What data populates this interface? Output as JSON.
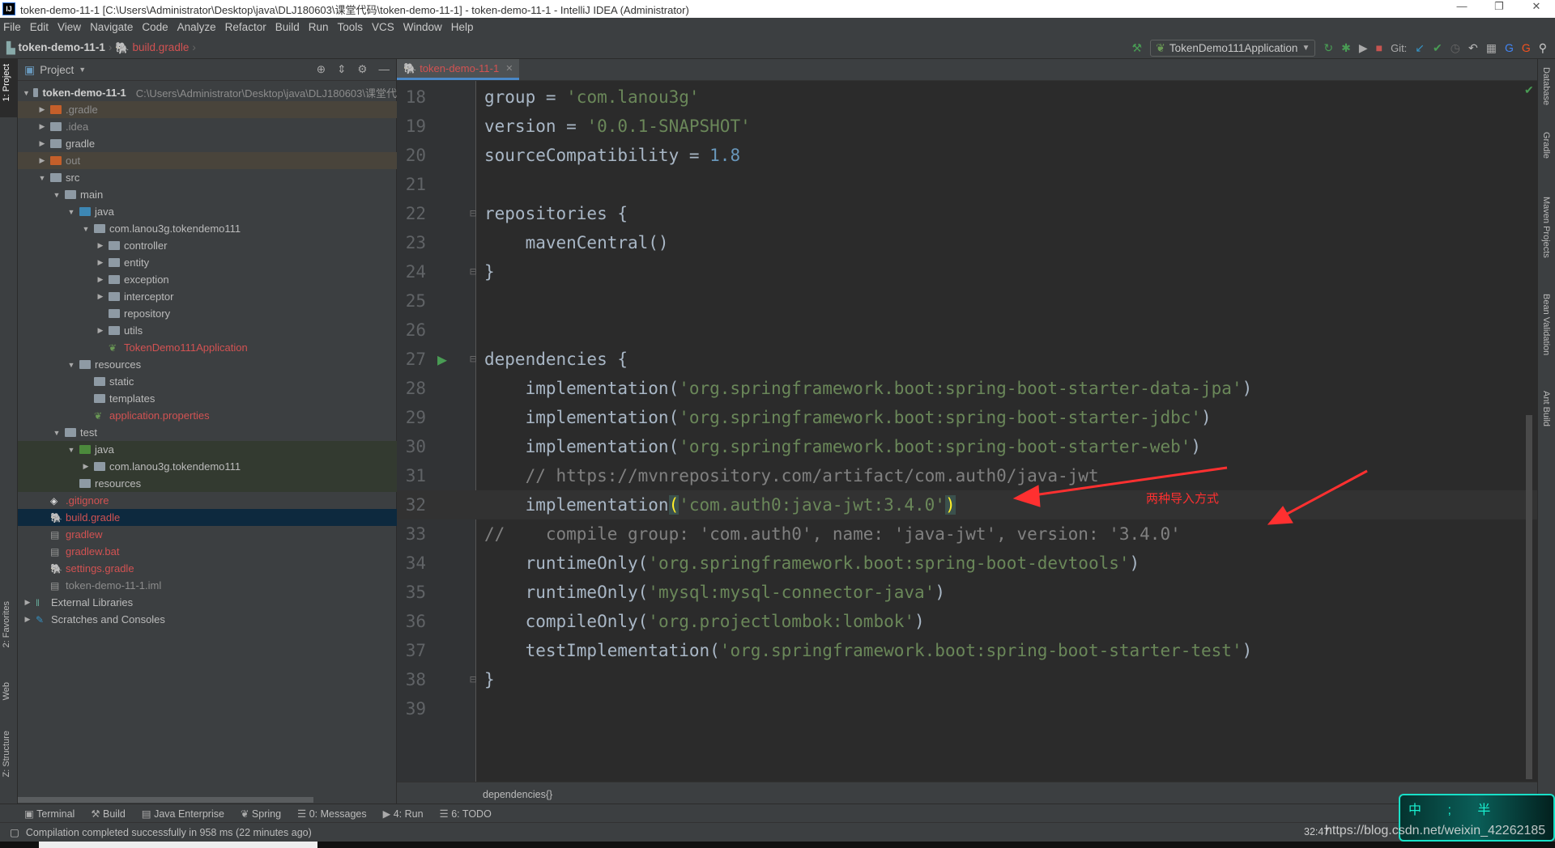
{
  "window": {
    "title": "token-demo-11-1 [C:\\Users\\Administrator\\Desktop\\java\\DLJ180603\\课堂代码\\token-demo-11-1] - token-demo-11-1 - IntelliJ IDEA (Administrator)",
    "logo": "IJ"
  },
  "menu": [
    "File",
    "Edit",
    "View",
    "Navigate",
    "Code",
    "Analyze",
    "Refactor",
    "Build",
    "Run",
    "Tools",
    "VCS",
    "Window",
    "Help"
  ],
  "nav": {
    "project": "token-demo-11-1",
    "file": "build.gradle"
  },
  "toolbar": {
    "run_config": "TokenDemo111Application",
    "git_label": "Git:"
  },
  "left_tabs": [
    "1: Project",
    "2: Favorites",
    "Web",
    "Z: Structure"
  ],
  "project_panel": {
    "title": "Project",
    "tree": [
      {
        "label": "token-demo-11-1",
        "path": "C:\\Users\\Administrator\\Desktop\\java\\DLJ180603\\课堂代",
        "depth": 0,
        "arrow": "down",
        "icon": "module",
        "style": "bold"
      },
      {
        "label": ".gradle",
        "depth": 1,
        "arrow": "right",
        "icon": "excluded",
        "style": "excluded"
      },
      {
        "label": ".idea",
        "depth": 1,
        "arrow": "right",
        "icon": "folder",
        "style": "dim"
      },
      {
        "label": "gradle",
        "depth": 1,
        "arrow": "right",
        "icon": "folder",
        "style": "normal"
      },
      {
        "label": "out",
        "depth": 1,
        "arrow": "right",
        "icon": "excluded",
        "style": "excluded"
      },
      {
        "label": "src",
        "depth": 1,
        "arrow": "down",
        "icon": "folder",
        "style": "normal"
      },
      {
        "label": "main",
        "depth": 2,
        "arrow": "down",
        "icon": "module",
        "style": "normal"
      },
      {
        "label": "java",
        "depth": 3,
        "arrow": "down",
        "icon": "source",
        "style": "normal"
      },
      {
        "label": "com.lanou3g.tokendemo111",
        "depth": 4,
        "arrow": "down",
        "icon": "package",
        "style": "normal"
      },
      {
        "label": "controller",
        "depth": 5,
        "arrow": "right",
        "icon": "package",
        "style": "normal"
      },
      {
        "label": "entity",
        "depth": 5,
        "arrow": "right",
        "icon": "package",
        "style": "normal"
      },
      {
        "label": "exception",
        "depth": 5,
        "arrow": "right",
        "icon": "package",
        "style": "normal"
      },
      {
        "label": "interceptor",
        "depth": 5,
        "arrow": "right",
        "icon": "package",
        "style": "normal"
      },
      {
        "label": "repository",
        "depth": 5,
        "arrow": "none",
        "icon": "package",
        "style": "normal"
      },
      {
        "label": "utils",
        "depth": 5,
        "arrow": "right",
        "icon": "package",
        "style": "normal"
      },
      {
        "label": "TokenDemo111Application",
        "depth": 5,
        "arrow": "none",
        "icon": "spring",
        "style": "red"
      },
      {
        "label": "resources",
        "depth": 3,
        "arrow": "down",
        "icon": "resources",
        "style": "normal"
      },
      {
        "label": "static",
        "depth": 4,
        "arrow": "none",
        "icon": "package",
        "style": "normal"
      },
      {
        "label": "templates",
        "depth": 4,
        "arrow": "none",
        "icon": "package",
        "style": "normal"
      },
      {
        "label": "application.properties",
        "depth": 4,
        "arrow": "none",
        "icon": "spring",
        "style": "red"
      },
      {
        "label": "test",
        "depth": 2,
        "arrow": "down",
        "icon": "module",
        "style": "normal"
      },
      {
        "label": "java",
        "depth": 3,
        "arrow": "down",
        "icon": "test",
        "style": "test"
      },
      {
        "label": "com.lanou3g.tokendemo111",
        "depth": 4,
        "arrow": "right",
        "icon": "package",
        "style": "test"
      },
      {
        "label": "resources",
        "depth": 3,
        "arrow": "none",
        "icon": "resources",
        "style": "test"
      },
      {
        "label": ".gitignore",
        "depth": 1,
        "arrow": "none",
        "icon": "git",
        "style": "red"
      },
      {
        "label": "build.gradle",
        "depth": 1,
        "arrow": "none",
        "icon": "gradle",
        "style": "selected"
      },
      {
        "label": "gradlew",
        "depth": 1,
        "arrow": "none",
        "icon": "file",
        "style": "red"
      },
      {
        "label": "gradlew.bat",
        "depth": 1,
        "arrow": "none",
        "icon": "file",
        "style": "red"
      },
      {
        "label": "settings.gradle",
        "depth": 1,
        "arrow": "none",
        "icon": "gradle",
        "style": "red"
      },
      {
        "label": "token-demo-11-1.iml",
        "depth": 1,
        "arrow": "none",
        "icon": "file",
        "style": "dim"
      },
      {
        "label": "External Libraries",
        "depth": 0,
        "arrow": "right",
        "icon": "libs",
        "style": "normal"
      },
      {
        "label": "Scratches and Consoles",
        "depth": 0,
        "arrow": "right",
        "icon": "scratch",
        "style": "normal"
      }
    ]
  },
  "editor": {
    "tab": "token-demo-11-1",
    "lines": [
      {
        "n": "18",
        "t": [
          [
            "group = ",
            ""
          ],
          [
            "'com.lanou3g'",
            "s"
          ]
        ]
      },
      {
        "n": "19",
        "t": [
          [
            "version = ",
            ""
          ],
          [
            "'0.0.1-SNAPSHOT'",
            "s"
          ]
        ]
      },
      {
        "n": "20",
        "t": [
          [
            "sourceCompatibility = ",
            ""
          ],
          [
            "1.8",
            "n"
          ]
        ]
      },
      {
        "n": "21",
        "t": []
      },
      {
        "n": "22",
        "t": [
          [
            "repositories {",
            ""
          ]
        ]
      },
      {
        "n": "23",
        "t": [
          [
            "    mavenCentral()",
            ""
          ]
        ]
      },
      {
        "n": "24",
        "t": [
          [
            "}",
            ""
          ]
        ]
      },
      {
        "n": "25",
        "t": []
      },
      {
        "n": "26",
        "t": []
      },
      {
        "n": "27",
        "t": [
          [
            "dependencies {",
            ""
          ]
        ]
      },
      {
        "n": "28",
        "t": [
          [
            "    implementation(",
            ""
          ],
          [
            "'org.springframework.boot:spring-boot-starter-data-jpa'",
            "s"
          ],
          [
            ")",
            ""
          ]
        ]
      },
      {
        "n": "29",
        "t": [
          [
            "    implementation(",
            ""
          ],
          [
            "'org.springframework.boot:spring-boot-starter-jdbc'",
            "s"
          ],
          [
            ")",
            ""
          ]
        ]
      },
      {
        "n": "30",
        "t": [
          [
            "    implementation(",
            ""
          ],
          [
            "'org.springframework.boot:spring-boot-starter-web'",
            "s"
          ],
          [
            ")",
            ""
          ]
        ]
      },
      {
        "n": "31",
        "t": [
          [
            "    // https://mvnrepository.com/artifact/com.auth0/java-jwt",
            "c"
          ]
        ]
      },
      {
        "n": "32",
        "t": [
          [
            "    implementation",
            ""
          ],
          [
            "(",
            "hl"
          ],
          [
            "'com.auth0:java-jwt:3.4.0'",
            "s"
          ],
          [
            ")",
            "hl"
          ]
        ]
      },
      {
        "n": "33",
        "t": [
          [
            "//    compile group: 'com.auth0', name: 'java-jwt', version: '3.4.0'",
            "c"
          ]
        ]
      },
      {
        "n": "34",
        "t": [
          [
            "    runtimeOnly(",
            ""
          ],
          [
            "'org.springframework.boot:spring-boot-devtools'",
            "s"
          ],
          [
            ")",
            ""
          ]
        ]
      },
      {
        "n": "35",
        "t": [
          [
            "    runtimeOnly(",
            ""
          ],
          [
            "'mysql:mysql-connector-java'",
            "s"
          ],
          [
            ")",
            ""
          ]
        ]
      },
      {
        "n": "36",
        "t": [
          [
            "    compileOnly(",
            ""
          ],
          [
            "'org.projectlombok:lombok'",
            "s"
          ],
          [
            ")",
            ""
          ]
        ]
      },
      {
        "n": "37",
        "t": [
          [
            "    testImplementation(",
            ""
          ],
          [
            "'org.springframework.boot:spring-boot-starter-test'",
            "s"
          ],
          [
            ")",
            ""
          ]
        ]
      },
      {
        "n": "38",
        "t": [
          [
            "}",
            ""
          ]
        ]
      },
      {
        "n": "39",
        "t": []
      }
    ],
    "current_line": "32",
    "breadcrumb": "dependencies{}",
    "annotation": "两种导入方式"
  },
  "right_tabs": [
    "Database",
    "Gradle",
    "Maven Projects",
    "Bean Validation",
    "Ant Build"
  ],
  "bottom_tabs": [
    "Terminal",
    "Build",
    "Java Enterprise",
    "Spring",
    "0: Messages",
    "4: Run",
    "6: TODO"
  ],
  "status": {
    "message": "Compilation completed successfully in 958 ms (22 minutes ago)",
    "position": "32:47"
  },
  "watermark": {
    "text": "中 ; 半",
    "url": "https://blog.csdn.net/weixin_42262185"
  },
  "colors": {
    "bg": "#2b2b2b",
    "panel": "#3c3f41",
    "string": "#6a8759",
    "number": "#6897bb",
    "comment": "#808080",
    "ident": "#a9b7c6",
    "vcs_red": "#d25252",
    "arrow": "#ff3030"
  }
}
